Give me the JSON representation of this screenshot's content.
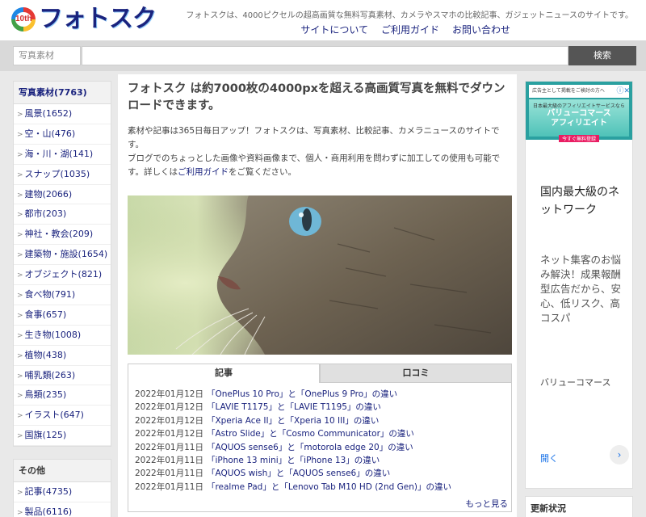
{
  "header": {
    "logo_badge": "10th",
    "logo_text": "フォトスク",
    "tagline": "フォトスクは、4000ピクセルの超高画質な無料写真素材、カメラやスマホの比較記事、ガジェットニュースのサイトです。",
    "nav": [
      "サイトについて",
      "ご利用ガイド",
      "お問い合わせ"
    ]
  },
  "search": {
    "label": "写真素材",
    "placeholder": "",
    "button": "検索"
  },
  "sidebar": {
    "heading": "写真素材(7763)",
    "items": [
      "風景(1652)",
      "空・山(476)",
      "海・川・湖(141)",
      "スナップ(1035)",
      "建物(2066)",
      "都市(203)",
      "神社・教会(209)",
      "建築物・施設(1654)",
      "オブジェクト(821)",
      "食べ物(791)",
      "食事(657)",
      "生き物(1008)",
      "植物(438)",
      "哺乳類(263)",
      "鳥類(235)",
      "イラスト(647)",
      "国旗(125)"
    ],
    "other_heading": "その他",
    "other_items": [
      "記事(4735)",
      "製品(6116)"
    ]
  },
  "main": {
    "title": "フォトスク は約7000枚の4000pxを超える高画質写真を無料でダウンロードできます。",
    "intro_1": "素材や記事は365日毎日アップ！フォトスクは、写真素材、比較記事、カメラニュースのサイトです。",
    "intro_2a": "ブログでのちょっとした画像や資料画像まで、個人・商用利用を問わずに加工しての使用も可能です。詳しくは",
    "intro_link": "ご利用ガイド",
    "intro_2b": "をご覧ください。",
    "tabs": [
      "記事",
      "口コミ"
    ],
    "news": [
      {
        "date": "2022年01月12日",
        "title": "「OnePlus 10 Pro」と「OnePlus 9 Pro」の違い"
      },
      {
        "date": "2022年01月12日",
        "title": "「LAVIE T1175」と「LAVIE T1195」の違い"
      },
      {
        "date": "2022年01月12日",
        "title": "「Xperia Ace II」と「Xperia 10 III」の違い"
      },
      {
        "date": "2022年01月12日",
        "title": "「Astro Slide」と「Cosmo Communicator」の違い"
      },
      {
        "date": "2022年01月11日",
        "title": "「AQUOS sense6」と「motorola edge 20」の違い"
      },
      {
        "date": "2022年01月11日",
        "title": "「iPhone 13 mini」と「iPhone 13」の違い"
      },
      {
        "date": "2022年01月11日",
        "title": "「AQUOS wish」と「AQUOS sense6」の違い"
      },
      {
        "date": "2022年01月11日",
        "title": "「realme Pad」と「Lenovo Tab M10 HD (2nd Gen)」の違い"
      }
    ],
    "more": "もっと見る"
  },
  "ad": {
    "top_small": "広告主として掲載をご検討の方へ",
    "banner_small": "日本最大級のアフィリエイトサービスなら",
    "banner_title_1": "バリューコマース",
    "banner_title_2": "アフィリエイト",
    "banner_cta": "今すぐ無料登録",
    "headline": "国内最大級のネットワーク",
    "body": "ネット集客のお悩み解決！成果報酬型広告だから、安心、低リスク、高コスパ",
    "brand": "バリューコマース",
    "open": "開く",
    "colors": {
      "teal": "#2aa0a0",
      "link": "#1a73e8"
    }
  },
  "updates": {
    "heading": "更新状況"
  }
}
